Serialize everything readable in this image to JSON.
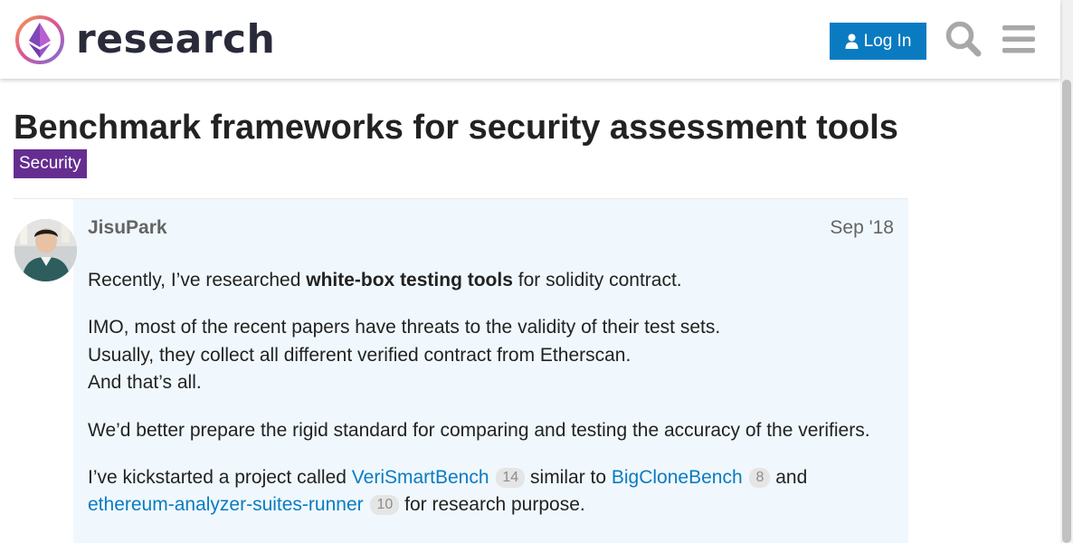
{
  "header": {
    "site_name": "research",
    "login_label": "Log In",
    "icons": [
      "search-icon",
      "hamburger-menu-icon",
      "user-icon"
    ]
  },
  "topic": {
    "title": "Benchmark frameworks for security assessment tools",
    "category": "Security",
    "category_color": "#652d90"
  },
  "post": {
    "username": "JisuPark",
    "date": "Sep '18",
    "p1_pre": "Recently, I’ve researched ",
    "p1_bold": "white-box testing tools",
    "p1_post": " for solidity contract.",
    "p2_line1": "IMO, most of the recent papers have threats to the validity of their test sets.",
    "p2_line2": "Usually, they collect all different verified contract from Etherscan.",
    "p2_line3": "And that’s all.",
    "p3": "We’d better prepare the rigid standard for comparing and testing the accuracy of the verifiers.",
    "p4_pre": "I’ve kickstarted a project called ",
    "link1_label": "VeriSmartBench",
    "link1_count": "14",
    "p4_mid": " similar to ",
    "link2_label": "BigCloneBench",
    "link2_count": "8",
    "p4_and": " and",
    "link3_label": "ethereum-analyzer-suites-runner",
    "link3_count": "10",
    "p4_post": " for research purpose."
  },
  "colors": {
    "accent": "#0a7bc1",
    "post_background": "#f0f8fd",
    "muted_text": "#646464"
  }
}
